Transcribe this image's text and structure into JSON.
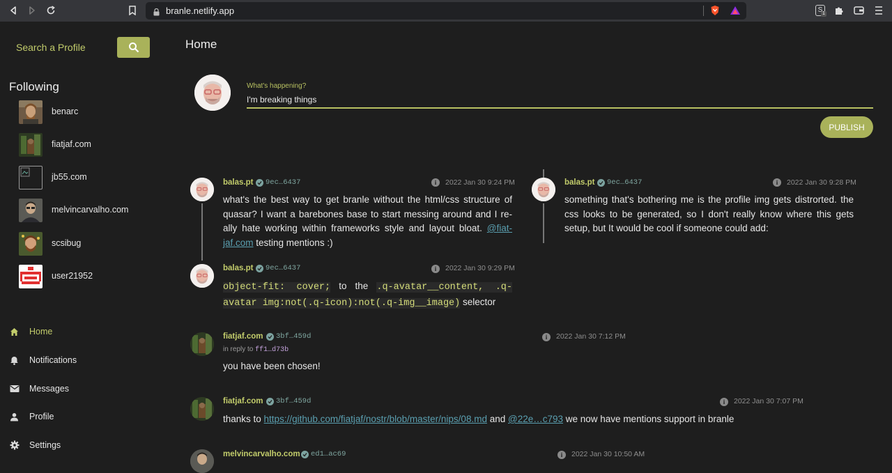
{
  "browser": {
    "url": "branle.netlify.app",
    "ext_badge": "1"
  },
  "sidebar": {
    "search_label": "Search a Profile",
    "following_title": "Following",
    "following": [
      {
        "name": "benarc"
      },
      {
        "name": "fiatjaf.com"
      },
      {
        "name": "jb55.com"
      },
      {
        "name": "melvincarvalho.com"
      },
      {
        "name": "scsibug"
      },
      {
        "name": "user21952"
      }
    ],
    "menu": [
      {
        "label": "Home",
        "icon": "home-icon",
        "active": true
      },
      {
        "label": "Notifications",
        "icon": "bell-icon"
      },
      {
        "label": "Messages",
        "icon": "mail-icon"
      },
      {
        "label": "Profile",
        "icon": "person-icon"
      },
      {
        "label": "Settings",
        "icon": "gear-icon"
      }
    ]
  },
  "main": {
    "title": "Home",
    "compose": {
      "label": "What's happening?",
      "value": "I'm breaking things",
      "publish": "PUBLISH"
    },
    "posts": [
      {
        "author": "balas.pt",
        "key": "9ec…6437",
        "time": "2022 Jan 30 9:24 PM",
        "body_1": "what's the best way to get branle without the html/css structure of quasar? I want a barebones base to start messing around and I re-ally hate working within frameworks style and layout bloat. ",
        "mention": "@fiat-jaf.com",
        "body_2": " testing mentions :)"
      },
      {
        "author": "balas.pt",
        "key": "9ec…6437",
        "time": "2022 Jan 30 9:28 PM",
        "body": "something that's bothering me is the profile img gets distrorted. the css looks to be generated, so I don't really know where this gets setup, but It would be cool if someone could add:"
      },
      {
        "author": "balas.pt",
        "key": "9ec…6437",
        "time": "2022 Jan 30 9:29 PM",
        "code_1": "object-fit: cover;",
        "text_1": " to the ",
        "code_2": ".q-avatar__content, .q-avatar img:not(.q-icon):not(.q-img__image)",
        "text_2": " selector"
      },
      {
        "author": "fiatjaf.com",
        "key": "3bf…459d",
        "time": "2022 Jan 30 7:12 PM",
        "reply_label": "in reply to ",
        "reply_key": "ff1…d73b",
        "body": "you have been chosen!"
      },
      {
        "author": "fiatjaf.com",
        "key": "3bf…459d",
        "time": "2022 Jan 30 7:07 PM",
        "body_1": "thanks to ",
        "link": "https://github.com/fiatjaf/nostr/blob/master/nips/08.md",
        "body_2": " and ",
        "mention": "@22e…c793",
        "body_3": " we now have mentions support in branle"
      },
      {
        "author": "melvincarvalho.com",
        "key": "ed1…ac69",
        "time": "2022 Jan 30 10:50 AM"
      }
    ]
  },
  "colors": {
    "accent": "#a9b25a",
    "accent_text": "#c2cc6b",
    "background": "#1e1e1e",
    "link": "#5a9fb0"
  }
}
